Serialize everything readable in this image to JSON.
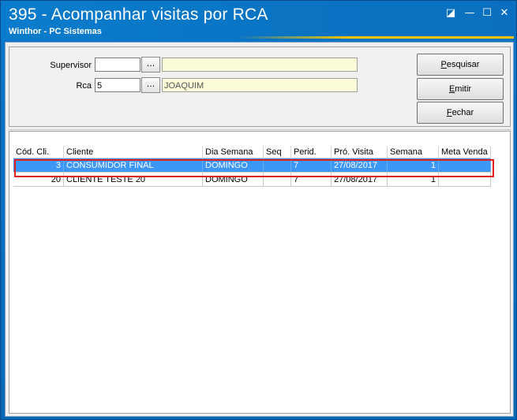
{
  "window": {
    "title": "395 - Acompanhar visitas por RCA",
    "subtitle": "Winthor - PC Sistemas",
    "controls": {
      "restore": "◪",
      "minimize": "—",
      "maximize": "☐",
      "close": "✕"
    }
  },
  "filters": {
    "supervisor": {
      "label": "Supervisor",
      "code": "",
      "name": ""
    },
    "rca": {
      "label": "Rca",
      "code": "5",
      "name": "JOAQUIM"
    },
    "ellipsis": "..."
  },
  "buttons": {
    "pesquisar": {
      "first": "P",
      "rest": "esquisar"
    },
    "emitir": {
      "first": "E",
      "rest": "mitir"
    },
    "fechar": {
      "first": "F",
      "rest": "echar"
    }
  },
  "grid": {
    "columns": [
      "Cód. Cli.",
      "Cliente",
      "Dia Semana",
      "Seq",
      "Perid.",
      "Pró. Visita",
      "Semana",
      "Meta Venda"
    ],
    "rows": [
      {
        "cod": "3",
        "cliente": "CONSUMIDOR FINAL",
        "dia": "DOMINGO",
        "seq": "",
        "perid": "7",
        "visita": "27/08/2017",
        "semana": "1",
        "meta": ""
      },
      {
        "cod": "20",
        "cliente": "CLIENTE TESTE 20",
        "dia": "DOMINGO",
        "seq": "",
        "perid": "7",
        "visita": "27/08/2017",
        "semana": "1",
        "meta": ""
      }
    ]
  },
  "colors": {
    "selection": "#3d97f5",
    "highlight_border": "#e02020",
    "titlebar": "#0a73c2",
    "accent": "#f6c400"
  }
}
